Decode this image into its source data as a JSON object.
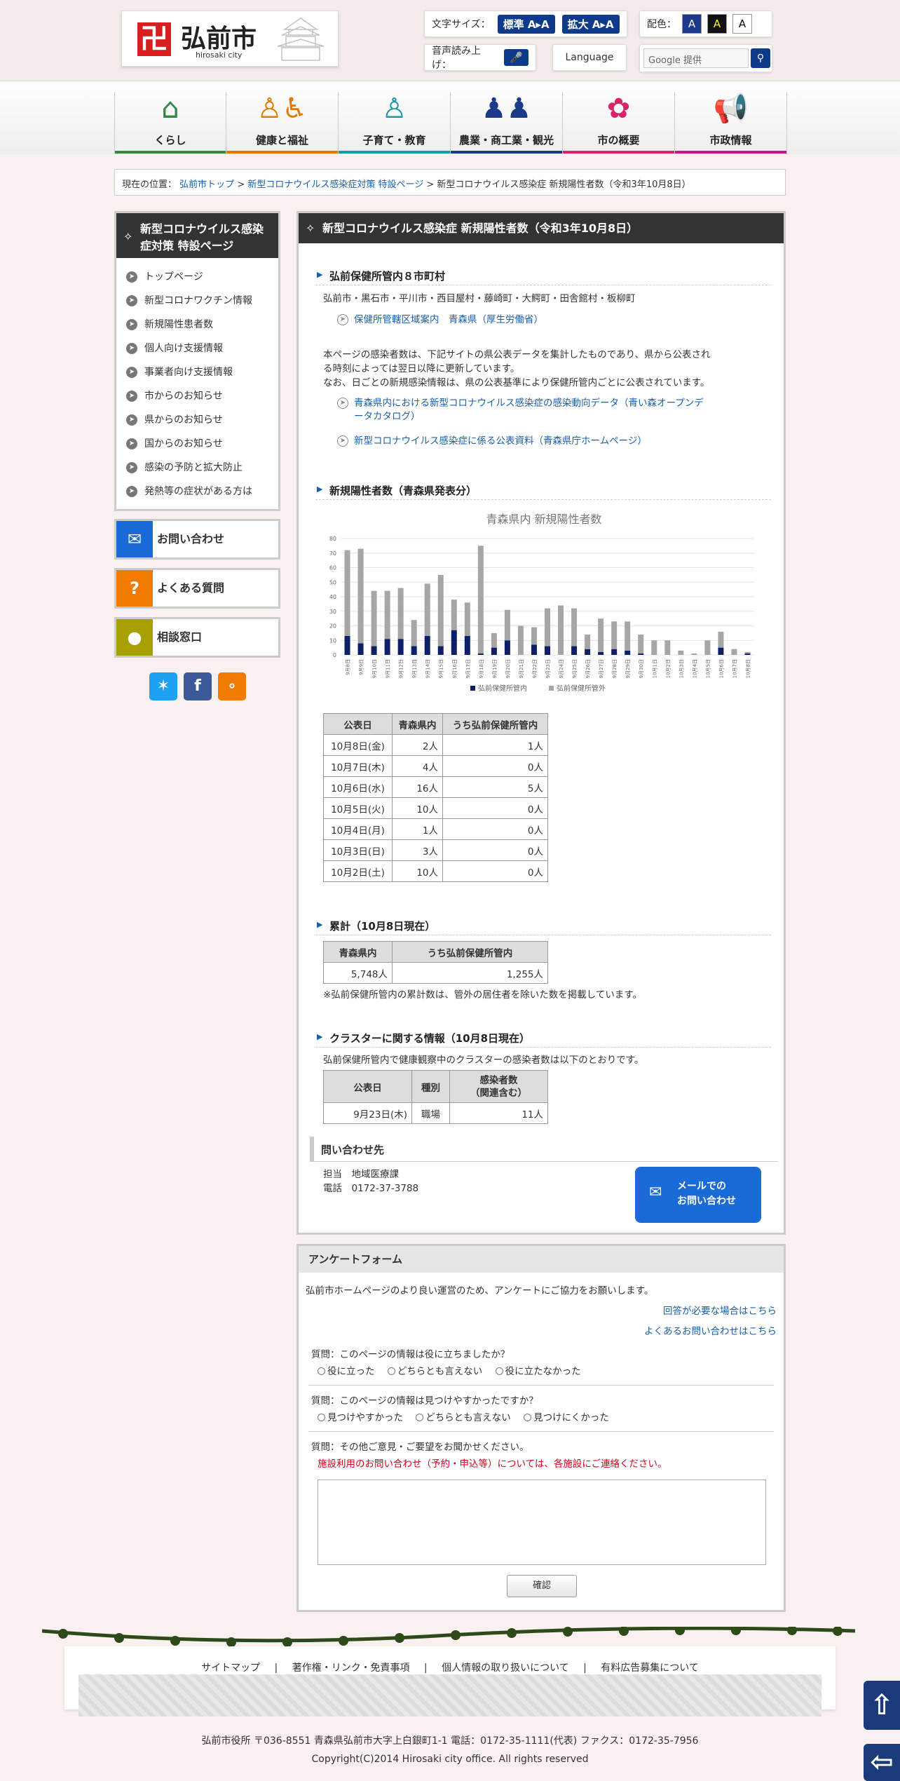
{
  "header": {
    "logo_name": "弘前市",
    "logo_sub": "hirosaki city",
    "fontsize_label": "文字サイズ：",
    "fontsize_std": "標準 A▸A",
    "fontsize_large": "拡大 A▸A",
    "color_label": "配色：",
    "color_options": [
      "A",
      "A",
      "A"
    ],
    "voice_label": "音声読み上げ：",
    "language": "Language",
    "search_placeholder": "Google 提供"
  },
  "nav": [
    {
      "label": "くらし",
      "icon": "house-icon",
      "color": "#2e8b3e"
    },
    {
      "label": "健康と福祉",
      "icon": "family-icon",
      "color": "#e07b00"
    },
    {
      "label": "子育て・教育",
      "icon": "child-icon",
      "color": "#1a9aa0"
    },
    {
      "label": "農業・商工業・観光",
      "icon": "workers-icon",
      "color": "#1b3a8a"
    },
    {
      "label": "市の概要",
      "icon": "sakura-icon",
      "color": "#d8246b"
    },
    {
      "label": "市政情報",
      "icon": "broadcast-icon",
      "color": "#c2168a"
    }
  ],
  "breadcrumb": {
    "prefix": "現在の位置：",
    "home": "弘前市トップ",
    "sep": ">",
    "parent": "新型コロナウイルス感染症対策 特設ページ",
    "current": "新型コロナウイルス感染症 新規陽性者数（令和3年10月8日）"
  },
  "sidebar": {
    "title": "新型コロナウイルス感染症対策 特設ページ",
    "items": [
      "トップページ",
      "新型コロナワクチン情報",
      "新規陽性患者数",
      "個人向け支援情報",
      "事業者向け支援情報",
      "市からのお知らせ",
      "県からのお知らせ",
      "国からのお知らせ",
      "感染の予防と拡大防止",
      "発熱等の症状がある方は"
    ],
    "contact": "お問い合わせ",
    "faq": "よくある質問",
    "consult": "相談窓口"
  },
  "main": {
    "title": "新型コロナウイルス感染症 新規陽性者数（令和3年10月8日）",
    "s1_heading": "弘前保健所管内８市町村",
    "s1_towns": "弘前市・黒石市・平川市・西目屋村・藤崎町・大鰐町・田舎館村・板柳町",
    "s1_link": "保健所管轄区域案内　青森県（厚生労働省）",
    "s1_note1": "本ページの感染者数は、下記サイトの県公表データを集計したものであり、県から公表され",
    "s1_note2": "る時刻によっては翌日以降に更新しています。",
    "s1_note3": "なお、日ごとの新規感染情報は、県の公表基準により保健所管内ごとに公表されています。",
    "s1_link2a": "青森県内における新型コロナウイルス感染症の感染動向データ（青い森オープンデ",
    "s1_link2b": "ータカタログ）",
    "s1_link3": "新型コロナウイルス感染症に係る公表資料（青森県庁ホームページ）",
    "s2_heading": "新規陽性者数（青森県発表分）",
    "table_headers": [
      "公表日",
      "青森県内",
      "うち弘前保健所管内"
    ],
    "table_rows": [
      [
        "10月8日(金)",
        "2人",
        "1人"
      ],
      [
        "10月7日(木)",
        "4人",
        "0人"
      ],
      [
        "10月6日(水)",
        "16人",
        "5人"
      ],
      [
        "10月5日(火)",
        "10人",
        "0人"
      ],
      [
        "10月4日(月)",
        "1人",
        "0人"
      ],
      [
        "10月3日(日)",
        "3人",
        "0人"
      ],
      [
        "10月2日(土)",
        "10人",
        "0人"
      ]
    ],
    "s3_heading": "累計（10月8日現在）",
    "total_headers": [
      "青森県内",
      "うち弘前保健所管内"
    ],
    "total_values": [
      "5,748人",
      "1,255人"
    ],
    "total_note": "※弘前保健所管内の累計数は、管外の居住者を除いた数を掲載しています。",
    "s4_heading": "クラスターに関する情報（10月8日現在）",
    "s4_text": "弘前保健所管内で健康観察中のクラスターの感染者数は以下のとおりです。",
    "cluster_headers": [
      "公表日",
      "種別",
      "感染者数",
      "（関連含む）"
    ],
    "cluster_row": [
      "9月23日(木)",
      "職場",
      "11人"
    ],
    "contact_heading": "問い合わせ先",
    "contact_dept": "担当　地域医療課",
    "contact_tel": "電話　0172-37-3788",
    "mail_btn1": "メールでの",
    "mail_btn2": "お問い合わせ"
  },
  "chart_data": {
    "type": "bar",
    "title": "青森県内 新規陽性者数",
    "stacked": true,
    "ylim": [
      0,
      80
    ],
    "yticks": [
      0,
      10,
      20,
      30,
      40,
      50,
      60,
      70,
      80
    ],
    "categories": [
      "9月8日",
      "9月9日",
      "9月10日",
      "9月11日",
      "9月12日",
      "9月13日",
      "9月14日",
      "9月15日",
      "9月16日",
      "9月17日",
      "9月18日",
      "9月19日",
      "9月20日",
      "9月21日",
      "9月22日",
      "9月23日",
      "9月24日",
      "9月25日",
      "9月26日",
      "9月27日",
      "9月28日",
      "9月29日",
      "9月30日",
      "10月1日",
      "10月2日",
      "10月3日",
      "10月4日",
      "10月5日",
      "10月6日",
      "10月7日",
      "10月8日"
    ],
    "series": [
      {
        "name": "弘前保健所管内",
        "color": "#0d1f66",
        "values": [
          13,
          8,
          6,
          11,
          11,
          6,
          13,
          6,
          17,
          13,
          1,
          5,
          10,
          0,
          7,
          6,
          0,
          6,
          4,
          2,
          4,
          3,
          1,
          0,
          0,
          0,
          0,
          0,
          5,
          0,
          1
        ]
      },
      {
        "name": "弘前保健所管外",
        "color": "#a6a6a6",
        "values": [
          59,
          65,
          38,
          33,
          35,
          18,
          36,
          49,
          21,
          23,
          74,
          10,
          21,
          20,
          12,
          26,
          34,
          26,
          10,
          23,
          19,
          20,
          13,
          10,
          10,
          3,
          1,
          10,
          11,
          4,
          1
        ]
      }
    ],
    "legend": "bottom"
  },
  "survey": {
    "title": "アンケートフォーム",
    "intro": "弘前市ホームページのより良い運営のため、アンケートにご協力をお願いします。",
    "link1": "回答が必要な場合はこちら",
    "link2": "よくあるお問い合わせはこちら",
    "q1": "質問：このページの情報は役に立ちましたか？",
    "q1_opts": [
      "役に立った",
      "どちらとも言えない",
      "役に立たなかった"
    ],
    "q2": "質問：このページの情報は見つけやすかったですか？",
    "q2_opts": [
      "見つけやすかった",
      "どちらとも言えない",
      "見つけにくかった"
    ],
    "q3": "質問：その他ご意見・ご要望をお聞かせください。",
    "warning": "施設利用のお問い合わせ（予約・申込等）については、各施設にご連絡ください。",
    "submit": "確認"
  },
  "footer": {
    "links": [
      "サイトマップ",
      "著作権・リンク・免責事項",
      "個人情報の取り扱いについて",
      "有料広告募集について"
    ],
    "sep": "|",
    "address": "弘前市役所 〒036-8551 青森県弘前市大字上白銀町1-1 電話：0172-35-1111(代表) ファクス：0172-35-7956",
    "copyright": "Copyright(C)2014 Hirosaki city office. All rights reserved"
  }
}
